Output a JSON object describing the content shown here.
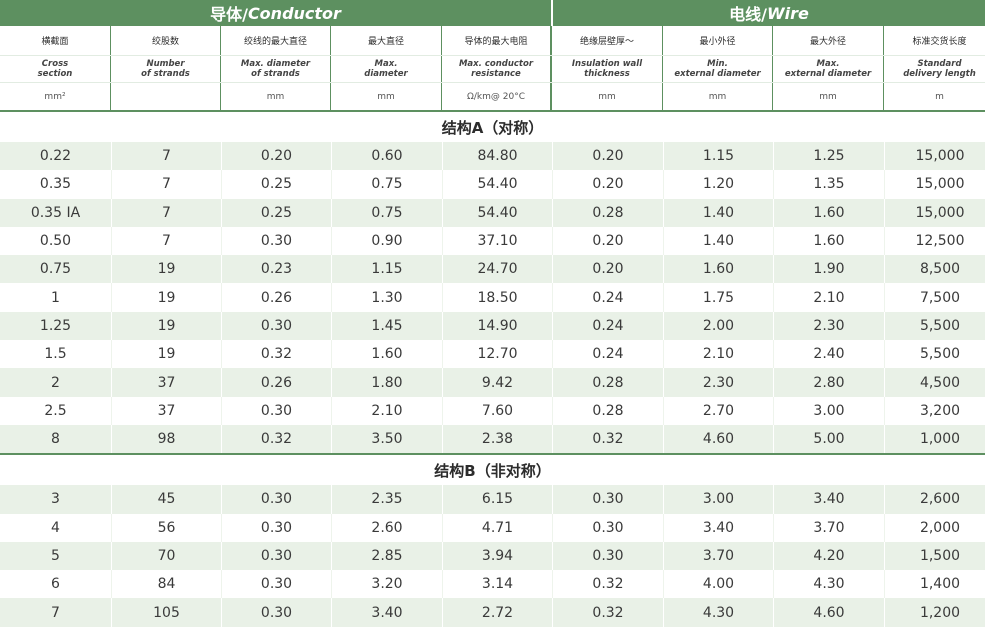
{
  "header": {
    "conductor_zh": "导体/",
    "conductor_en": "Conductor",
    "wire_zh": "电线/",
    "wire_en": "Wire"
  },
  "columns": [
    {
      "zh": "横截面",
      "en1": "Cross",
      "en2": "section",
      "unit": "mm²"
    },
    {
      "zh": "绞股数",
      "en1": "Number",
      "en2": "of strands",
      "unit": ""
    },
    {
      "zh": "绞线的最大直径",
      "en1": "Max. diameter",
      "en2": "of strands",
      "unit": "mm"
    },
    {
      "zh": "最大直径",
      "en1": "Max.",
      "en2": "diameter",
      "unit": "mm"
    },
    {
      "zh": "导体的最大电阻",
      "en1": "Max. conductor",
      "en2": "resistance",
      "unit": "Ω/km@ 20°C"
    },
    {
      "zh": "绝缘层壁厚～",
      "en1": "Insulation wall",
      "en2": "thickness",
      "unit": "mm"
    },
    {
      "zh": "最小外径",
      "en1": "Min.",
      "en2": "external diameter",
      "unit": "mm"
    },
    {
      "zh": "最大外径",
      "en1": "Max.",
      "en2": "external diameter",
      "unit": "mm"
    },
    {
      "zh": "标准交货长度",
      "en1": "Standard",
      "en2": "delivery length",
      "unit": "m"
    }
  ],
  "sections": [
    {
      "title": "结构A（对称）",
      "rows": [
        [
          "0.22",
          "7",
          "0.20",
          "0.60",
          "84.80",
          "0.20",
          "1.15",
          "1.25",
          "15,000"
        ],
        [
          "0.35",
          "7",
          "0.25",
          "0.75",
          "54.40",
          "0.20",
          "1.20",
          "1.35",
          "15,000"
        ],
        [
          "0.35 IA",
          "7",
          "0.25",
          "0.75",
          "54.40",
          "0.28",
          "1.40",
          "1.60",
          "15,000"
        ],
        [
          "0.50",
          "7",
          "0.30",
          "0.90",
          "37.10",
          "0.20",
          "1.40",
          "1.60",
          "12,500"
        ],
        [
          "0.75",
          "19",
          "0.23",
          "1.15",
          "24.70",
          "0.20",
          "1.60",
          "1.90",
          "8,500"
        ],
        [
          "1",
          "19",
          "0.26",
          "1.30",
          "18.50",
          "0.24",
          "1.75",
          "2.10",
          "7,500"
        ],
        [
          "1.25",
          "19",
          "0.30",
          "1.45",
          "14.90",
          "0.24",
          "2.00",
          "2.30",
          "5,500"
        ],
        [
          "1.5",
          "19",
          "0.32",
          "1.60",
          "12.70",
          "0.24",
          "2.10",
          "2.40",
          "5,500"
        ],
        [
          "2",
          "37",
          "0.26",
          "1.80",
          "9.42",
          "0.28",
          "2.30",
          "2.80",
          "4,500"
        ],
        [
          "2.5",
          "37",
          "0.30",
          "2.10",
          "7.60",
          "0.28",
          "2.70",
          "3.00",
          "3,200"
        ],
        [
          "8",
          "98",
          "0.32",
          "3.50",
          "2.38",
          "0.32",
          "4.60",
          "5.00",
          "1,000"
        ]
      ]
    },
    {
      "title": "结构B（非对称）",
      "rows": [
        [
          "3",
          "45",
          "0.30",
          "2.35",
          "6.15",
          "0.30",
          "3.00",
          "3.40",
          "2,600"
        ],
        [
          "4",
          "56",
          "0.30",
          "2.60",
          "4.71",
          "0.30",
          "3.40",
          "3.70",
          "2,000"
        ],
        [
          "5",
          "70",
          "0.30",
          "2.85",
          "3.94",
          "0.30",
          "3.70",
          "4.20",
          "1,500"
        ],
        [
          "6",
          "84",
          "0.30",
          "3.20",
          "3.14",
          "0.32",
          "4.00",
          "4.30",
          "1,400"
        ],
        [
          "7",
          "105",
          "0.30",
          "3.40",
          "2.72",
          "0.32",
          "4.30",
          "4.60",
          "1,200"
        ]
      ]
    }
  ]
}
